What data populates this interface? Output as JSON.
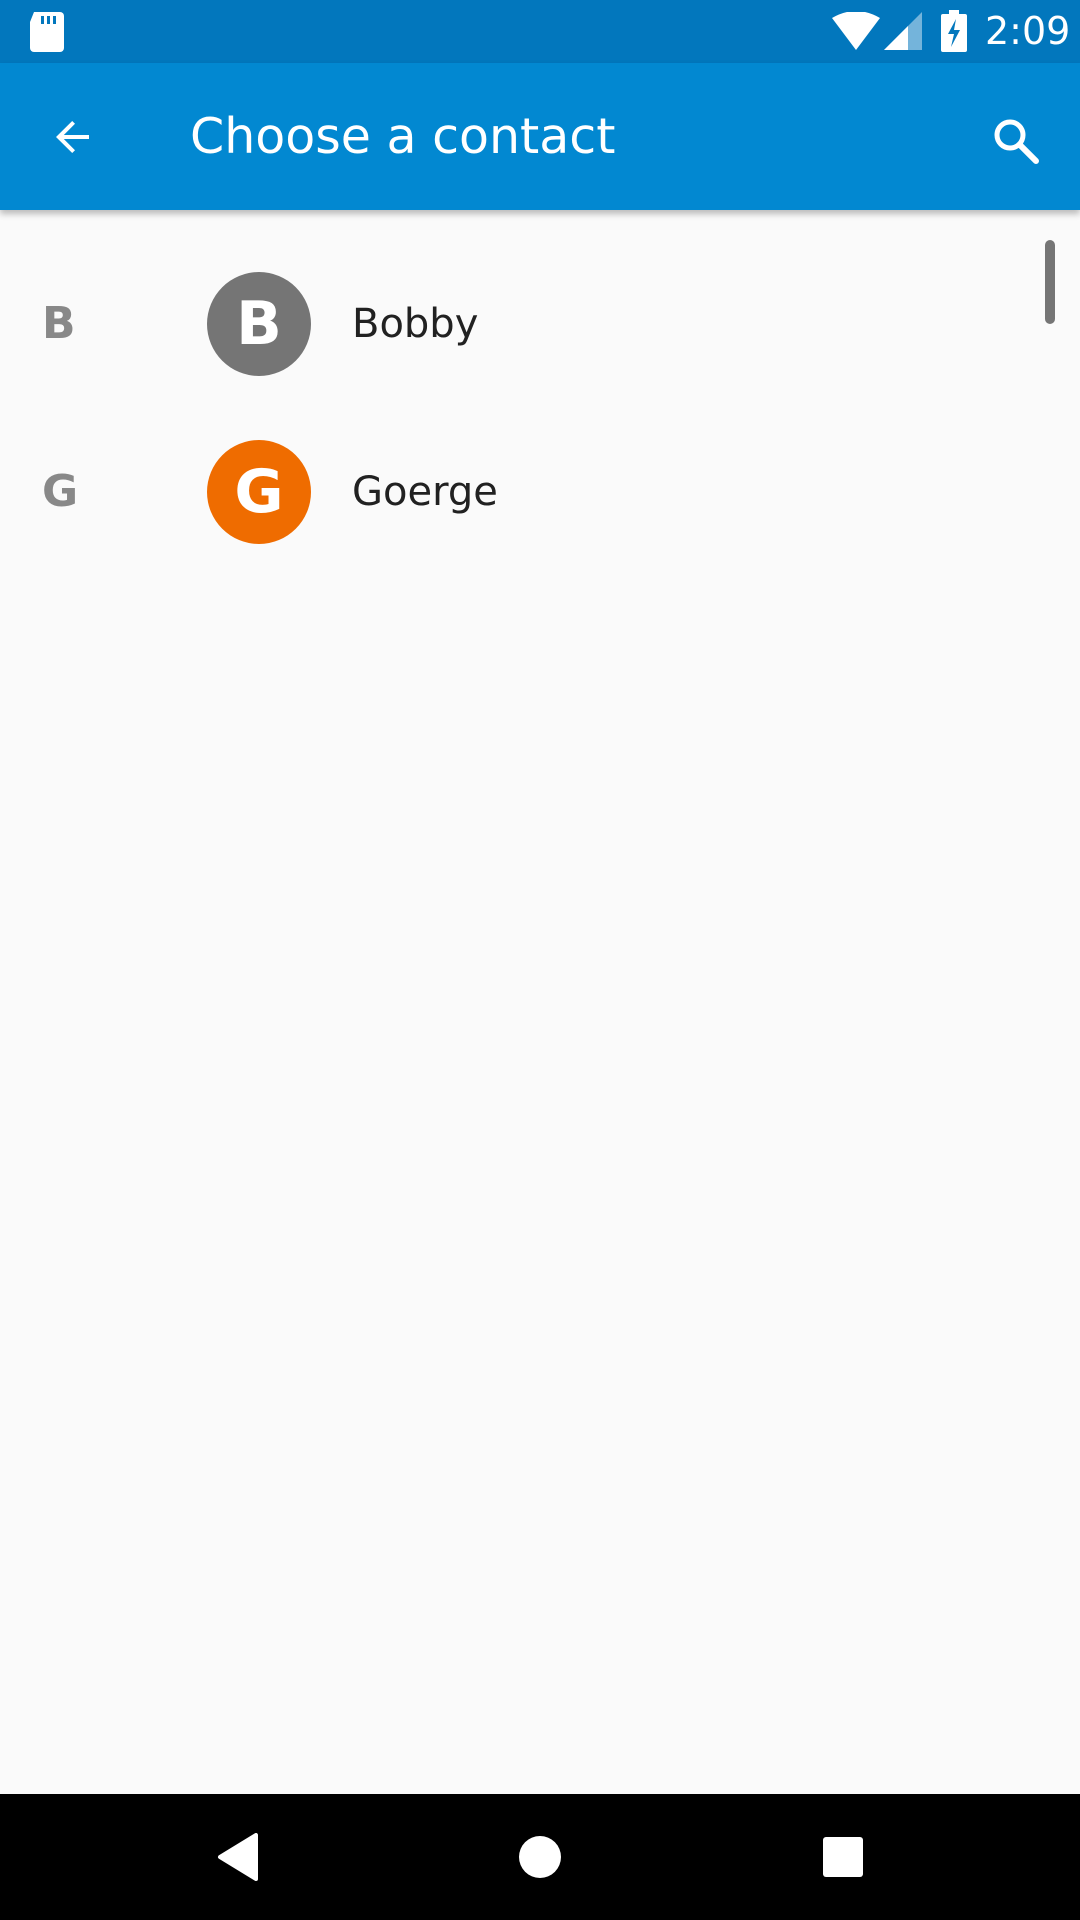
{
  "status_bar": {
    "time": "2:09",
    "icons": [
      "sd-card-icon",
      "wifi-icon",
      "signal-icon",
      "battery-charging-icon"
    ],
    "background": "#0277bd"
  },
  "app_bar": {
    "title": "Choose a contact",
    "back_icon": "arrow-back-icon",
    "search_icon": "search-icon",
    "background": "#0288d1"
  },
  "contacts": [
    {
      "section": "B",
      "initial": "B",
      "name": "Bobby",
      "avatar_color": "#757575"
    },
    {
      "section": "G",
      "initial": "G",
      "name": "Goerge",
      "avatar_color": "#ef6c00"
    }
  ],
  "nav_bar": {
    "icons": [
      "back-triangle-icon",
      "home-circle-icon",
      "recents-square-icon"
    ]
  }
}
